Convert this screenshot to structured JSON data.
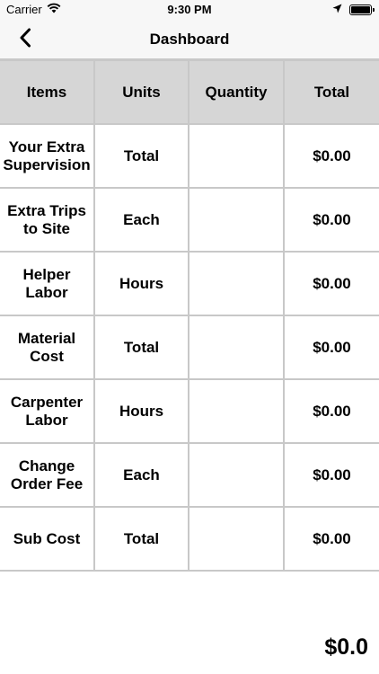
{
  "status_bar": {
    "carrier": "Carrier",
    "time": "9:30 PM"
  },
  "nav": {
    "title": "Dashboard",
    "back_icon": "chevron-left-icon"
  },
  "table": {
    "headers": [
      "Items",
      "Units",
      "Quantity",
      "Total"
    ],
    "rows": [
      {
        "item": "Your Extra Supervision",
        "unit": "Total",
        "quantity": "",
        "total": "$0.00"
      },
      {
        "item": "Extra Trips to Site",
        "unit": "Each",
        "quantity": "",
        "total": "$0.00"
      },
      {
        "item": "Helper Labor",
        "unit": "Hours",
        "quantity": "",
        "total": "$0.00"
      },
      {
        "item": "Material Cost",
        "unit": "Total",
        "quantity": "",
        "total": "$0.00"
      },
      {
        "item": "Carpenter Labor",
        "unit": "Hours",
        "quantity": "",
        "total": "$0.00"
      },
      {
        "item": "Change Order Fee",
        "unit": "Each",
        "quantity": "",
        "total": "$0.00"
      },
      {
        "item": "Sub Cost",
        "unit": "Total",
        "quantity": "",
        "total": "$0.00"
      }
    ]
  },
  "grand_total": "$0.0",
  "colors": {
    "header_bg": "#d6d6d6",
    "grid_line": "#c8c8c8",
    "bar_bg": "#f7f7f7"
  }
}
